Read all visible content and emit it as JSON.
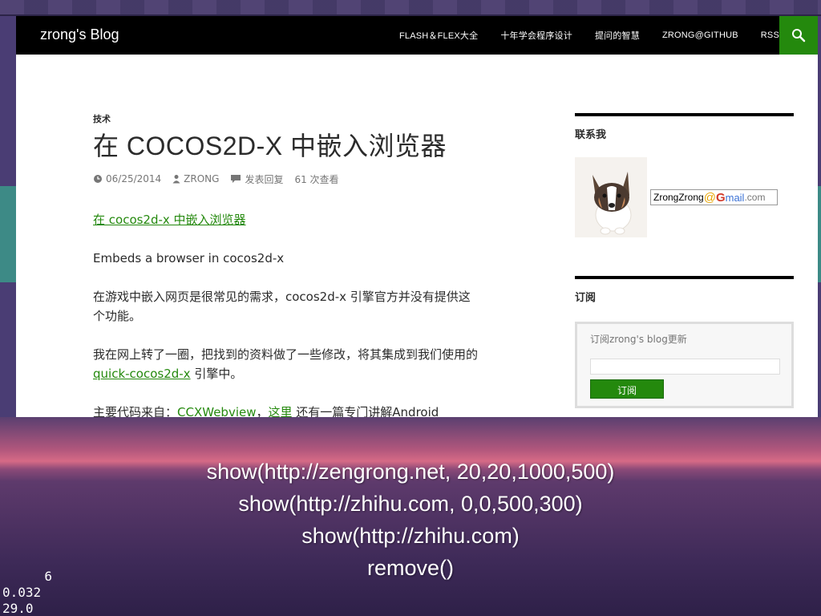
{
  "site": {
    "title": "zrong's Blog"
  },
  "nav": {
    "items": [
      "FLASH＆FLEX大全",
      "十年学会程序设计",
      "提问的智慧",
      "ZRONG@GITHUB",
      "RSS"
    ],
    "search_icon": "search-icon"
  },
  "post": {
    "category": "技术",
    "title": "在 COCOS2D-X 中嵌入浏览器",
    "date": "06/25/2014",
    "author": "ZRONG",
    "reply": "发表回复",
    "views": "61 次查看",
    "link_title": "在 cocos2d-x 中嵌入浏览器",
    "p1": "Embeds a browser in cocos2d-x",
    "p2": "在游戏中嵌入网页是很常见的需求，cocos2d-x 引擎官方并没有提供这个功能。",
    "p3_a": "我在网上转了一圈，把找到的资料做了一些修改，将其集成到我们使用的 ",
    "p3_link": "quick-cocos2d-x",
    "p3_b": " 引擎中。",
    "p4_a": "主要代码来自：",
    "p4_link1": "CCXWebview",
    "p4_sep": "，",
    "p4_link2": "这里",
    "p4_b": " 还有一篇专门讲解Android"
  },
  "sidebar": {
    "contact_title": "联系我",
    "gmail_user": "ZrongZrong",
    "gmail_at": "@",
    "gmail_g": "G",
    "gmail_mail": "mail",
    "gmail_com": ".com",
    "subscribe_title": "订阅",
    "subscribe_text": "订阅zrong's blog更新",
    "subscribe_button": "订阅"
  },
  "overlay": {
    "commands": [
      "show(http://zengrong.net, 20,20,1000,500)",
      "show(http://zhihu.com, 0,0,500,300)",
      "show(http://zhihu.com)",
      "remove()"
    ]
  },
  "stats": [
    "6",
    "0.032",
    "29.0"
  ],
  "colors": {
    "accent": "#24890d",
    "header": "#000000"
  }
}
